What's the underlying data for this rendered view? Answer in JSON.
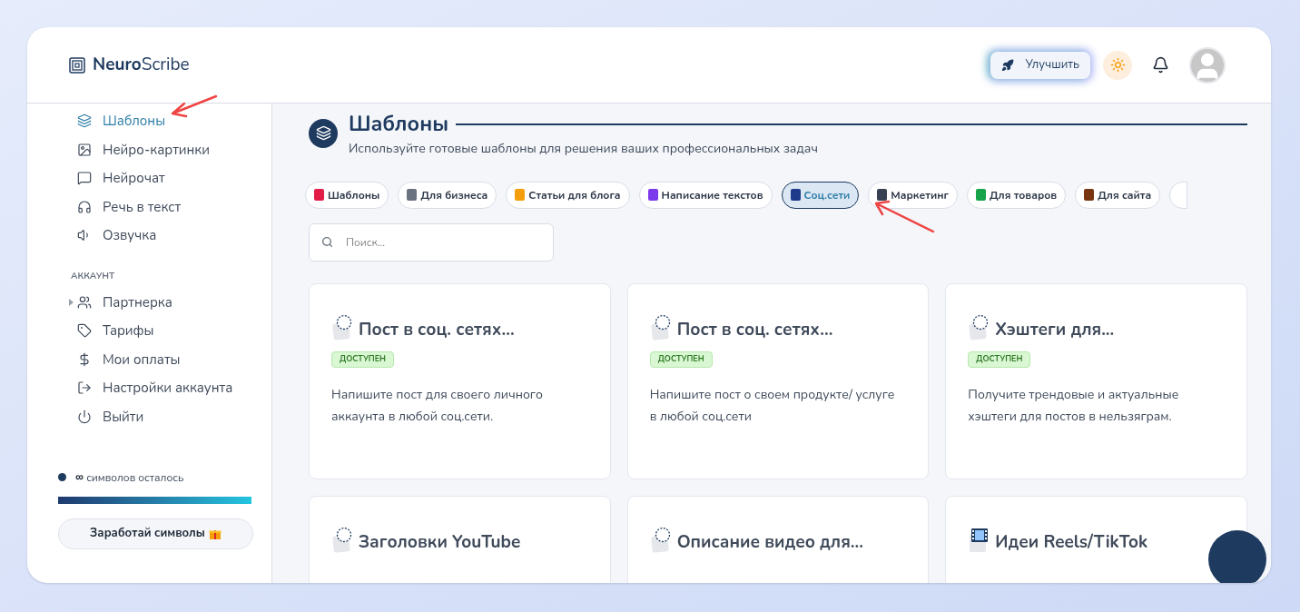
{
  "brand": {
    "bold": "Neuro",
    "rest": "Scribe"
  },
  "header": {
    "upgrade_button": "Улучшить"
  },
  "sidebar": {
    "items": [
      {
        "label": "Шаблоны",
        "selected": true
      },
      {
        "label": "Нейро-картинки",
        "selected": false
      },
      {
        "label": "Нейрочат",
        "selected": false
      },
      {
        "label": "Речь в текст",
        "selected": false
      },
      {
        "label": "Озвучка",
        "selected": false
      }
    ],
    "section_title": "АККАУНТ",
    "account_items": [
      {
        "label": "Партнерка",
        "expandable": true,
        "selected": false
      },
      {
        "label": "Тарифы",
        "expandable": false,
        "selected": false
      },
      {
        "label": "Мои оплаты",
        "expandable": false,
        "selected": false
      },
      {
        "label": "Настройки аккаунта",
        "expandable": false,
        "selected": false
      },
      {
        "label": "Выйти",
        "expandable": false,
        "selected": false
      }
    ],
    "symbols": {
      "count": "∞",
      "label": "символов осталось",
      "level": 1
    },
    "earn_button": "Заработай символы"
  },
  "page": {
    "title": "Шаблоны",
    "subtitle": "Используйте готовые шаблоны для решения ваших профессиональных задач"
  },
  "categories": [
    {
      "label": "Шаблоны",
      "selected": false
    },
    {
      "label": "Для бизнеса",
      "selected": false
    },
    {
      "label": "Статьи для блога",
      "selected": false
    },
    {
      "label": "Написание текстов",
      "selected": false
    },
    {
      "label": "Соц.сети",
      "selected": true
    },
    {
      "label": "Маркетинг",
      "selected": false
    },
    {
      "label": "Для товаров",
      "selected": false
    },
    {
      "label": "Для сайта",
      "selected": false
    }
  ],
  "search": {
    "placeholder": "Поиск..."
  },
  "cards": [
    {
      "title": "Пост в соц. сетях...",
      "badge": "ДОСТУПЕН",
      "description": "Напишите пост для своего личного аккаунта в любой соц.сети.",
      "kind": "note"
    },
    {
      "title": "Пост в соц. сетях...",
      "badge": "ДОСТУПЕН",
      "description": "Напишите пост о своем продукте/ услуге в любой соц.сети",
      "kind": "note"
    },
    {
      "title": "Хэштеги для...",
      "badge": "ДОСТУПЕН",
      "description": "Получите трендовые и актуальные хэштеги для постов в нельзяграм.",
      "kind": "note"
    },
    {
      "title": "Заголовки YouTube",
      "kind": "note"
    },
    {
      "title": "Описание видео для...",
      "kind": "note"
    },
    {
      "title": "Идеи Reels/TikTok",
      "kind": "film"
    }
  ]
}
